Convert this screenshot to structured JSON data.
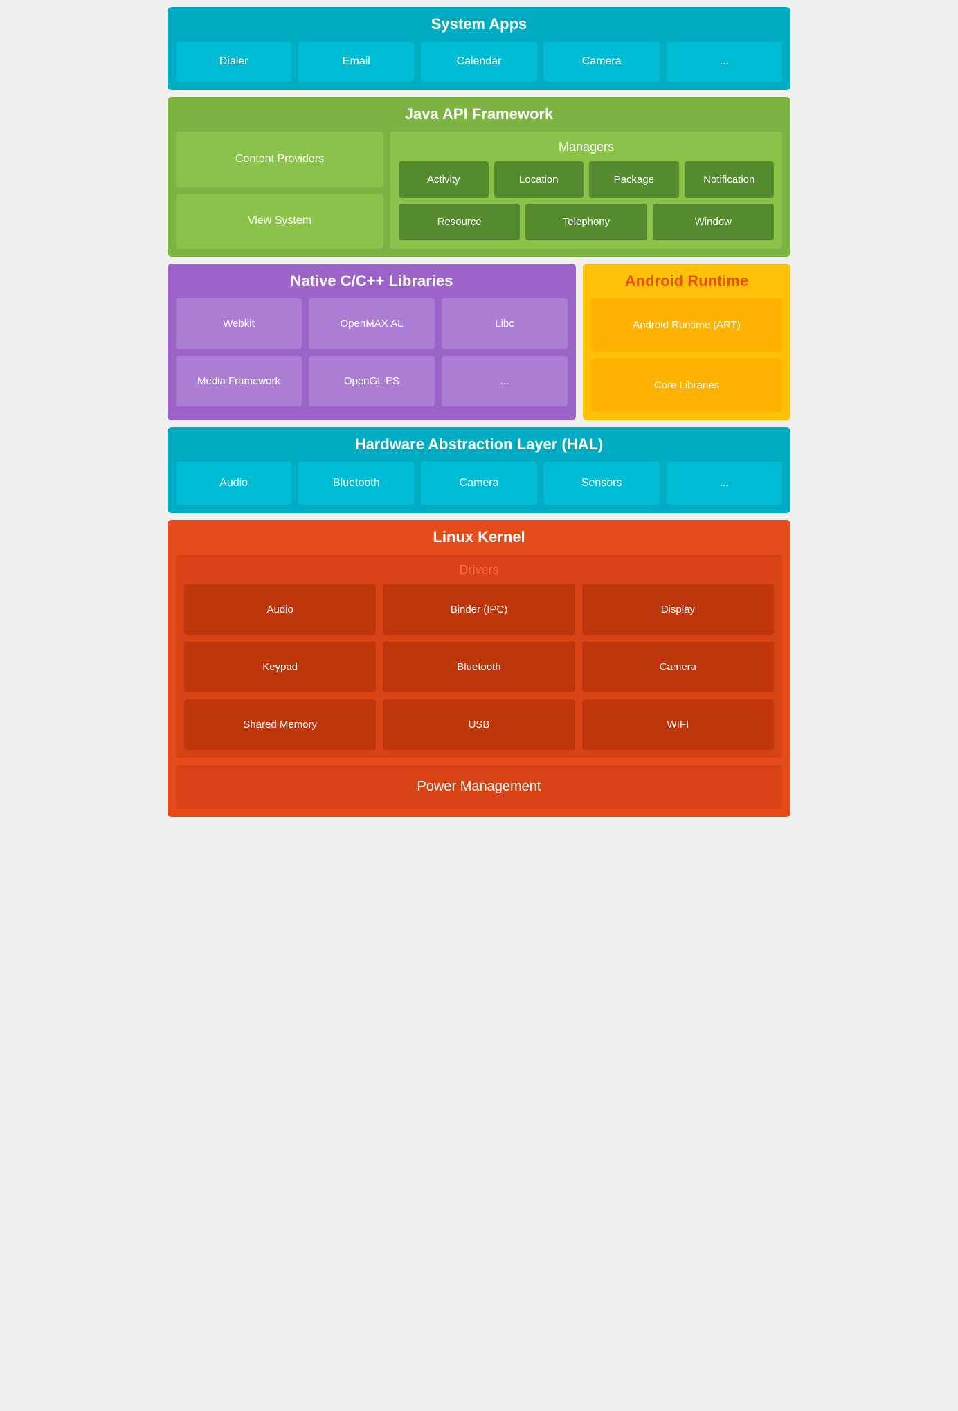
{
  "systemApps": {
    "title": "System Apps",
    "items": [
      "Dialer",
      "Email",
      "Calendar",
      "Camera",
      "..."
    ]
  },
  "javaApi": {
    "title": "Java API Framework",
    "left": {
      "items": [
        "Content Providers",
        "View System"
      ]
    },
    "right": {
      "managersTitle": "Managers",
      "rows": [
        [
          "Activity",
          "Location",
          "Package",
          "Notification"
        ],
        [
          "Resource",
          "Telephony",
          "Window"
        ]
      ]
    }
  },
  "nativeLibs": {
    "title": "Native C/C++ Libraries",
    "items": [
      "Webkit",
      "OpenMAX AL",
      "Libc",
      "Media Framework",
      "OpenGL ES",
      "..."
    ]
  },
  "androidRuntime": {
    "title": "Android Runtime",
    "items": [
      "Android Runtime (ART)",
      "Core Libraries"
    ]
  },
  "hal": {
    "title": "Hardware Abstraction Layer (HAL)",
    "items": [
      "Audio",
      "Bluetooth",
      "Camera",
      "Sensors",
      "..."
    ]
  },
  "linuxKernel": {
    "title": "Linux Kernel",
    "driversTitle": "Drivers",
    "drivers": [
      "Audio",
      "Binder (IPC)",
      "Display",
      "Keypad",
      "Bluetooth",
      "Camera",
      "Shared Memory",
      "USB",
      "WIFI"
    ],
    "powerManagement": "Power Management"
  }
}
